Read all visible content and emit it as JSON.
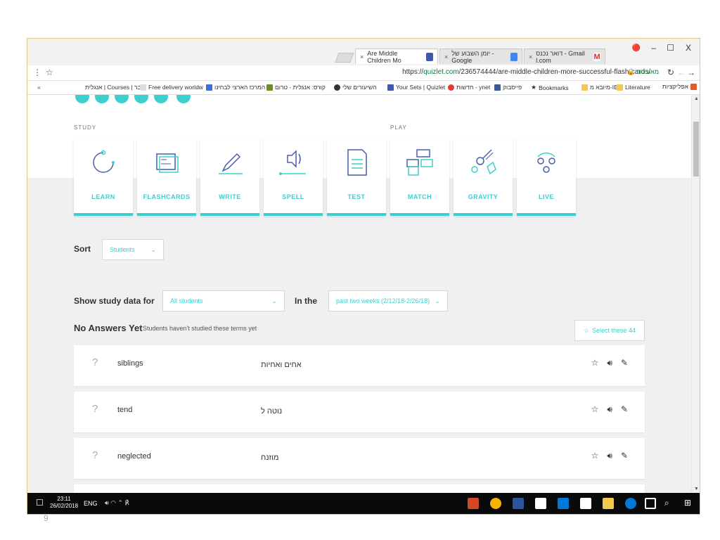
{
  "tabs": [
    {
      "title": "Are Middle Children Mo",
      "active": true
    },
    {
      "title": "יומן השבוע של - Google",
      "active": false
    },
    {
      "title": "דואר נכנס - Gmail l.com",
      "active": false
    }
  ],
  "window_controls": {
    "minimize": "–",
    "maximize": "☐",
    "close": "X",
    "profile": "🔴"
  },
  "address_bar": {
    "protocol": "https://",
    "host": "quizlet.com",
    "path": "/236574444/are-middle-children-more-successful-flash-cards/",
    "secure_label": "מאובטח"
  },
  "bookmarks": [
    "אפליקציות",
    "Literature",
    "מיובא מ-IE",
    "Bookmarks",
    "פייסבוק",
    "חדשות - ynet",
    "Your Sets | Quizlet",
    "השיעורים שלי",
    "קורס: אנגלית - טרום",
    "המרכז הארצי לבחינו",
    "Free delivery worldw",
    "אנגלית | Courses | בר"
  ],
  "bookmarks_more": "«",
  "study": {
    "section_study": "STUDY",
    "section_play": "PLAY",
    "modes": [
      "LEARN",
      "FLASHCARDS",
      "WRITE",
      "SPELL",
      "TEST",
      "MATCH",
      "GRAVITY",
      "LIVE"
    ]
  },
  "sort": {
    "label": "Sort",
    "value": "Students"
  },
  "study_data": {
    "label": "Show study data for",
    "value": "All students",
    "in_the_label": "In the",
    "range": "past two weeks (2/12/18-2/26/18)"
  },
  "no_answers": {
    "title": "No Answers Yet",
    "subtitle": "Students haven't studied these terms yet",
    "select_label": "Select these 44"
  },
  "terms": [
    {
      "term": "siblings",
      "definition": "אחים ואחיות"
    },
    {
      "term": "tend",
      "definition": "נוטה ל"
    },
    {
      "term": "neglected",
      "definition": "מוזנח"
    }
  ],
  "taskbar": {
    "time": "23:11",
    "date": "26/02/2018",
    "lang": "ENG"
  },
  "slide_number": "9"
}
